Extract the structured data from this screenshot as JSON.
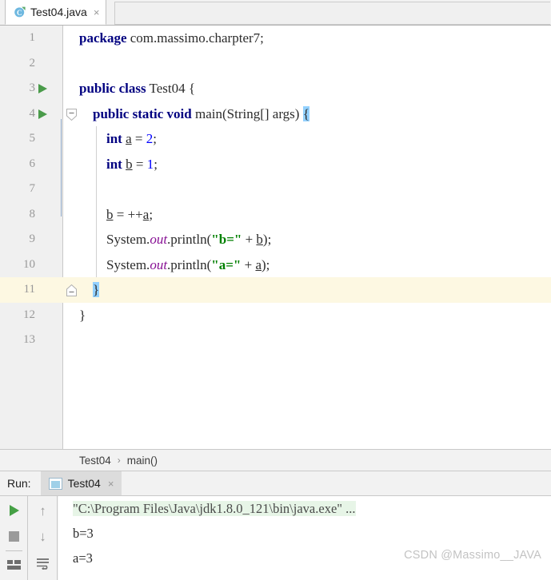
{
  "tab": {
    "label": "Test04.java",
    "icon": "java-class-icon",
    "close": "×"
  },
  "editor": {
    "lines": [
      {
        "n": "1",
        "runmark": false,
        "fold": "",
        "current": false,
        "indent_guide": false
      },
      {
        "n": "2",
        "runmark": false,
        "fold": "",
        "current": false,
        "indent_guide": false
      },
      {
        "n": "3",
        "runmark": true,
        "fold": "",
        "current": false,
        "indent_guide": false
      },
      {
        "n": "4",
        "runmark": true,
        "fold": "down",
        "current": false,
        "indent_guide": false
      },
      {
        "n": "5",
        "runmark": false,
        "fold": "",
        "current": false,
        "indent_guide": true
      },
      {
        "n": "6",
        "runmark": false,
        "fold": "",
        "current": false,
        "indent_guide": true
      },
      {
        "n": "7",
        "runmark": false,
        "fold": "",
        "current": false,
        "indent_guide": true
      },
      {
        "n": "8",
        "runmark": false,
        "fold": "",
        "current": false,
        "indent_guide": true
      },
      {
        "n": "9",
        "runmark": false,
        "fold": "",
        "current": false,
        "indent_guide": true
      },
      {
        "n": "10",
        "runmark": false,
        "fold": "",
        "current": false,
        "indent_guide": true
      },
      {
        "n": "11",
        "runmark": false,
        "fold": "up",
        "current": true,
        "indent_guide": false
      },
      {
        "n": "12",
        "runmark": false,
        "fold": "",
        "current": false,
        "indent_guide": false
      },
      {
        "n": "13",
        "runmark": false,
        "fold": "",
        "current": false,
        "indent_guide": false
      }
    ],
    "code_text": [
      "package com.massimo.charpter7;",
      "",
      "public class Test04 {",
      "    public static void main(String[] args) {",
      "        int a = 2;",
      "        int b = 1;",
      "",
      "        b = ++a;",
      "        System.out.println(\"b=\" + b);",
      "        System.out.println(\"a=\" + a);",
      "    }",
      "}",
      ""
    ]
  },
  "breadcrumb": {
    "class": "Test04",
    "separator": "›",
    "method": "main()"
  },
  "run_panel": {
    "label": "Run:",
    "tab_label": "Test04",
    "tab_close": "×",
    "buttons": {
      "rerun": "rerun-button",
      "stop": "stop-button",
      "layout": "layout-button",
      "up": "↑",
      "down": "↓",
      "soft_wrap": "soft-wrap-button"
    },
    "console": {
      "command": "\"C:\\Program Files\\Java\\jdk1.8.0_121\\bin\\java.exe\" ...",
      "output": [
        "b=3",
        "a=3"
      ]
    },
    "watermark": "CSDN @Massimo__JAVA"
  },
  "colors": {
    "keyword": "#000080",
    "string": "#008000",
    "number": "#0000ff",
    "field": "#871094",
    "run_green": "#4a9b4a",
    "current_line": "#fdf8e2",
    "brace_highlight": "#93d1ff",
    "console_cmd_bg": "#e7f5e7"
  }
}
